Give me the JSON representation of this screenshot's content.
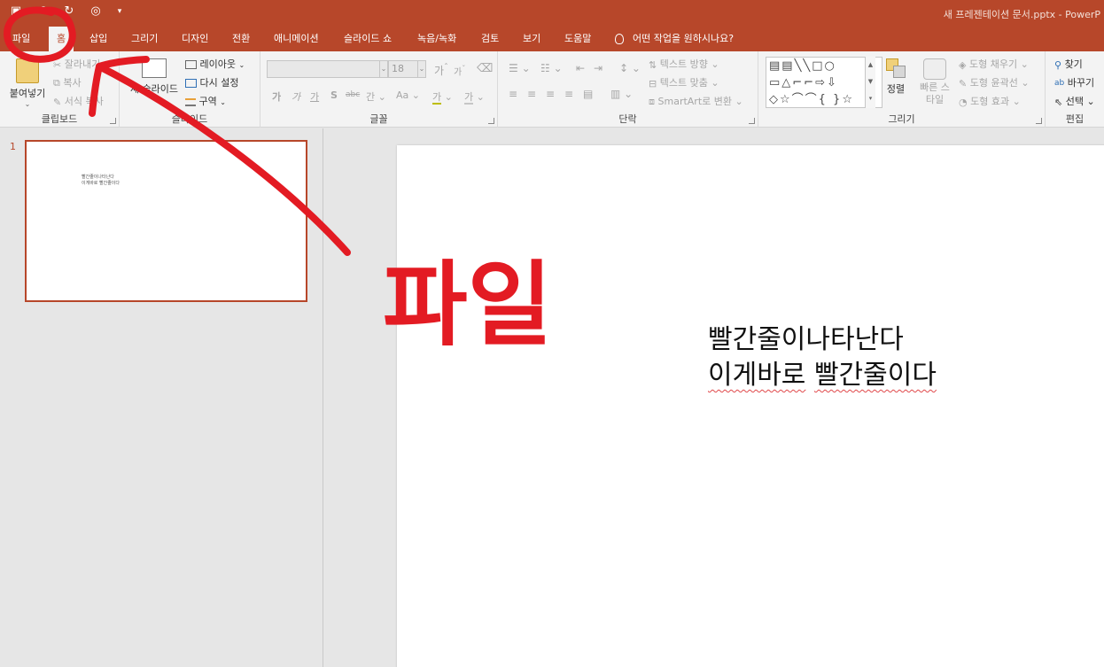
{
  "window": {
    "title": "새 프레젠테이션 문서.pptx  -  PowerP",
    "accent_color": "#b7472a",
    "quick_access": [
      "save-icon",
      "undo-icon",
      "redo-icon",
      "present-icon",
      "customize-icon"
    ]
  },
  "tabs": [
    {
      "id": "file",
      "label": "파일"
    },
    {
      "id": "home",
      "label": "홈"
    },
    {
      "id": "insert",
      "label": "삽입"
    },
    {
      "id": "draw",
      "label": "그리기"
    },
    {
      "id": "design",
      "label": "디자인"
    },
    {
      "id": "transitions",
      "label": "전환"
    },
    {
      "id": "animations",
      "label": "애니메이션"
    },
    {
      "id": "slideshow",
      "label": "슬라이드 쇼"
    },
    {
      "id": "record",
      "label": "녹음/녹화"
    },
    {
      "id": "review",
      "label": "검토"
    },
    {
      "id": "view",
      "label": "보기"
    },
    {
      "id": "help",
      "label": "도움말"
    }
  ],
  "active_tab": "홈",
  "tell_me": "어떤 작업을 원하시나요?",
  "ribbon": {
    "clipboard": {
      "label": "클립보드",
      "paste": "붙여넣기",
      "cut": "잘라내기",
      "copy": "복사",
      "format_painter": "서식 복사"
    },
    "slides": {
      "label": "슬라이드",
      "new_slide": "새 슬라이드",
      "layout": "레이아웃",
      "reset": "다시 설정",
      "section": "구역"
    },
    "font": {
      "label": "글꼴",
      "font_size": "18",
      "bold": "가",
      "italic": "가",
      "underline": "가",
      "shadow": "S",
      "strike": "abc",
      "spacing": "간",
      "case": "Aa",
      "highlight": "가",
      "color": "가",
      "grow": "가",
      "shrink": "가"
    },
    "paragraph": {
      "label": "단락",
      "text_direction": "텍스트 방향",
      "align_text": "텍스트 맞춤",
      "smartart": "SmartArt로 변환"
    },
    "drawing": {
      "label": "그리기",
      "arrange": "정렬",
      "quick_styles": "빠른 스타일",
      "shape_fill": "도형 채우기",
      "shape_outline": "도형 윤곽선",
      "shape_effects": "도형 효과"
    },
    "editing": {
      "label": "편집",
      "find": "찾기",
      "replace": "바꾸기",
      "select": "선택"
    }
  },
  "slides": [
    {
      "number": "1",
      "lines": [
        "빨간줄이나타난다",
        "이게바로 빨간줄이다"
      ]
    }
  ],
  "slide_text": {
    "line1": "빨간줄이나타난다",
    "line2": "이게바로",
    "line2b": "빨간줄이다"
  },
  "annotation": {
    "handwritten": "파일",
    "ink_color": "#e31b23"
  }
}
